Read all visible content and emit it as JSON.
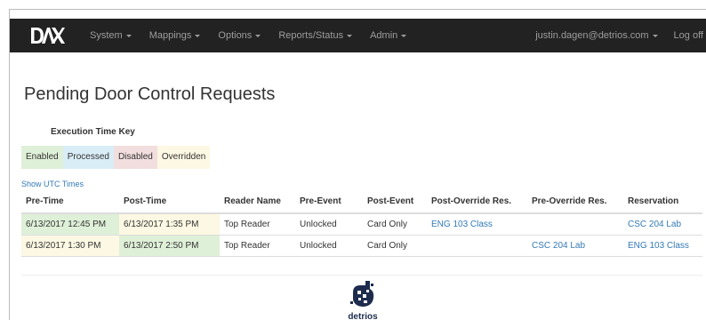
{
  "navbar": {
    "brand": "DAX",
    "menus": [
      {
        "label": "System"
      },
      {
        "label": "Mappings"
      },
      {
        "label": "Options"
      },
      {
        "label": "Reports/Status"
      },
      {
        "label": "Admin"
      }
    ],
    "user": "justin.dagen@detrios.com",
    "logoff": "Log off"
  },
  "page": {
    "title": "Pending Door Control Requests"
  },
  "key": {
    "title": "Execution Time Key",
    "items": [
      {
        "label": "Enabled",
        "color": "#dff0d8"
      },
      {
        "label": "Processed",
        "color": "#d9edf7"
      },
      {
        "label": "Disabled",
        "color": "#f2dede"
      },
      {
        "label": "Overridden",
        "color": "#fcf8e3"
      }
    ]
  },
  "utc_link": "Show UTC Times",
  "table": {
    "columns": [
      "Pre-Time",
      "Post-Time",
      "Reader Name",
      "Pre-Event",
      "Post-Event",
      "Post-Override Res.",
      "Pre-Override Res.",
      "Reservation"
    ],
    "rows": [
      {
        "pre_time": "6/13/2017 12:45 PM",
        "pre_color": "#dff0d8",
        "post_time": "6/13/2017 1:35 PM",
        "post_color": "#fcf8e3",
        "reader": "Top Reader",
        "pre_event": "Unlocked",
        "post_event": "Card Only",
        "post_override": "ENG 103 Class",
        "pre_override": "",
        "reservation": "CSC 204 Lab"
      },
      {
        "pre_time": "6/13/2017 1:30 PM",
        "pre_color": "#fcf8e3",
        "post_time": "6/13/2017 2:50 PM",
        "post_color": "#dff0d8",
        "reader": "Top Reader",
        "pre_event": "Unlocked",
        "post_event": "Card Only",
        "post_override": "",
        "pre_override": "CSC 204 Lab",
        "reservation": "ENG 103 Class"
      }
    ]
  },
  "footer": {
    "logo_text": "detrios"
  }
}
